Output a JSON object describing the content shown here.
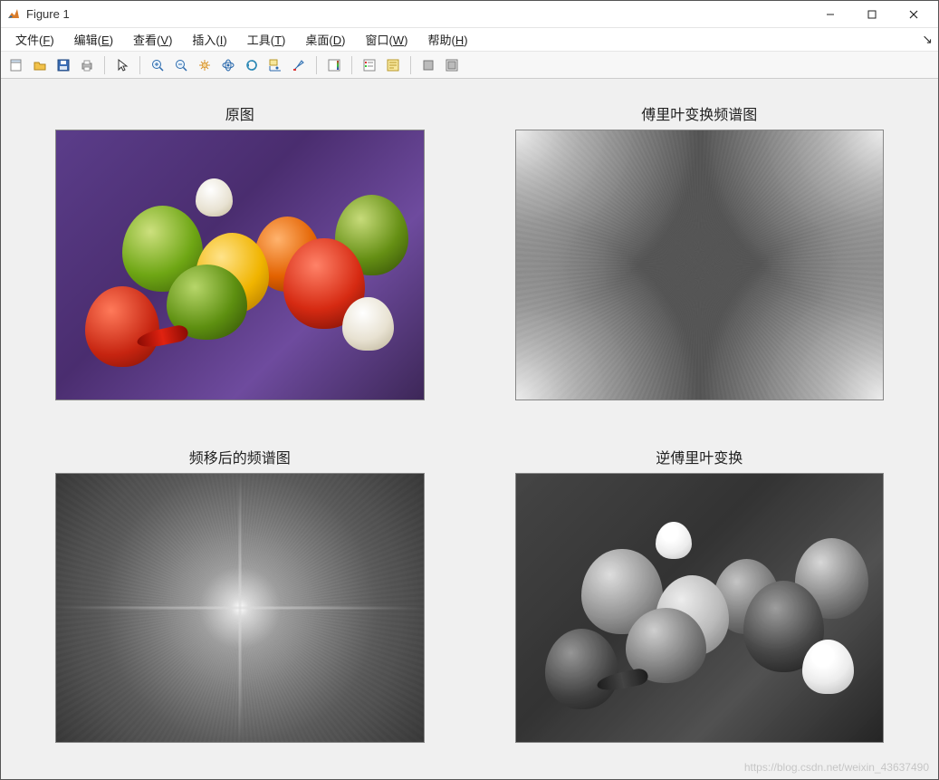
{
  "window": {
    "title": "Figure 1"
  },
  "menu": {
    "items": [
      {
        "label": "文件",
        "key": "F"
      },
      {
        "label": "编辑",
        "key": "E"
      },
      {
        "label": "查看",
        "key": "V"
      },
      {
        "label": "插入",
        "key": "I"
      },
      {
        "label": "工具",
        "key": "T"
      },
      {
        "label": "桌面",
        "key": "D"
      },
      {
        "label": "窗口",
        "key": "W"
      },
      {
        "label": "帮助",
        "key": "H"
      }
    ]
  },
  "toolbar": {
    "groups": [
      [
        "new-figure",
        "open",
        "save",
        "print"
      ],
      [
        "pointer"
      ],
      [
        "zoom-in",
        "zoom-out",
        "pan",
        "rotate-3d",
        "link-axes",
        "brush",
        "data-cursor"
      ],
      [
        "colorbar"
      ],
      [
        "new-script",
        "edit-plot"
      ],
      [
        "hide-plot-tools",
        "show-plot-tools"
      ]
    ]
  },
  "subplots": [
    {
      "title": "原图"
    },
    {
      "title": "傅里叶变换频谱图"
    },
    {
      "title": "频移后的频谱图"
    },
    {
      "title": "逆傅里叶变换"
    }
  ],
  "watermark": "https://blog.csdn.net/weixin_43637490"
}
